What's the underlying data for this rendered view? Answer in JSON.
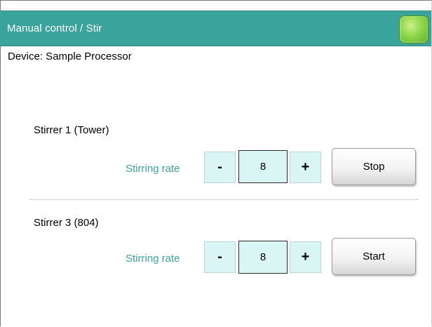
{
  "window": {
    "title": "Manual control / Stir"
  },
  "status_indicator": {
    "color": "#8fd64a",
    "icon": "status-led-icon"
  },
  "device": {
    "label": "Device: Sample Processor"
  },
  "stirrers": [
    {
      "name": "Stirrer 1 (Tower)",
      "rate_label": "Stirring rate",
      "decrement_label": "-",
      "rate_value": "8",
      "increment_label": "+",
      "action_label": "Stop"
    },
    {
      "name": "Stirrer 3 (804)",
      "rate_label": "Stirring rate",
      "decrement_label": "-",
      "rate_value": "8",
      "increment_label": "+",
      "action_label": "Start"
    }
  ],
  "colors": {
    "title_bar": "#3aa49c",
    "label_accent": "#3aa49c",
    "stepper_fill": "#d9f6f4"
  }
}
